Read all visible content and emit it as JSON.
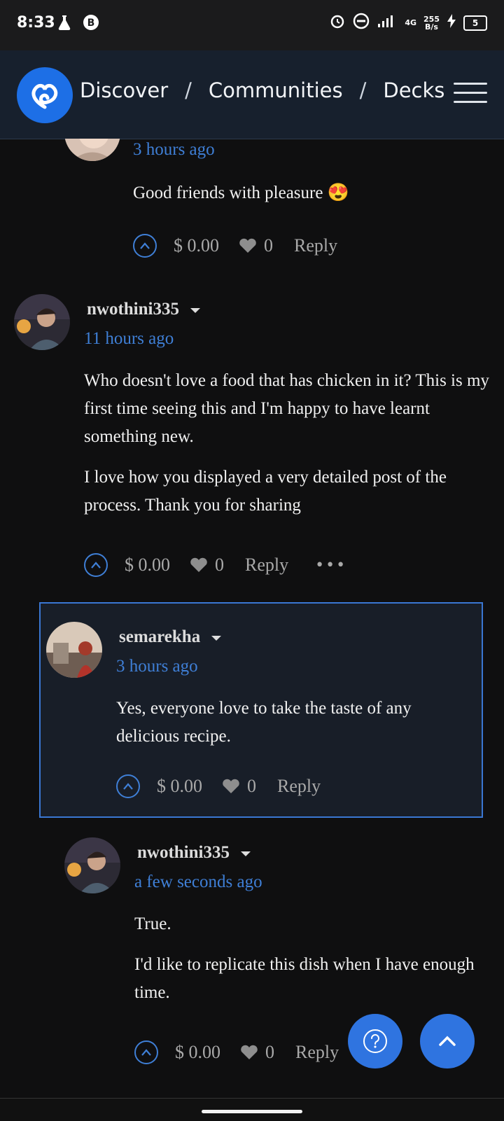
{
  "status_bar": {
    "time": "8:33",
    "net_speed_value": "255",
    "net_speed_unit": "B/s",
    "network_type": "4G",
    "battery": "5"
  },
  "header": {
    "breadcrumbs": [
      "Discover",
      "Communities",
      "Decks"
    ],
    "separator": "/"
  },
  "comments": [
    {
      "author": "",
      "time": "3 hours ago",
      "paragraphs": [
        "Good friends with pleasure 😍"
      ],
      "payout": "$ 0.00",
      "likes": "0",
      "reply_label": "Reply"
    },
    {
      "author": "nwothini335",
      "time": "11 hours ago",
      "paragraphs": [
        "Who doesn't love a food that has chicken in it? This is my first time seeing this and I'm happy to have learnt something new.",
        "I love how you displayed a very detailed post of the process. Thank you for sharing"
      ],
      "payout": "$ 0.00",
      "likes": "0",
      "reply_label": "Reply",
      "more_label": "•••"
    },
    {
      "author": "semarekha",
      "time": "3 hours ago",
      "paragraphs": [
        "Yes, everyone love to take the taste of any delicious recipe."
      ],
      "payout": "$ 0.00",
      "likes": "0",
      "reply_label": "Reply"
    },
    {
      "author": "nwothini335",
      "time": "a few seconds ago",
      "paragraphs": [
        "True.",
        "I'd like to replicate this dish when I have enough time."
      ],
      "payout": "$ 0.00",
      "likes": "0",
      "reply_label": "Reply"
    }
  ],
  "fab": {
    "help_icon": "question-circle-icon",
    "scroll_top_icon": "chevron-up-icon"
  },
  "colors": {
    "accent": "#2f74e0",
    "link": "#3f7fd6",
    "background": "#0f0f10",
    "header": "#17202d"
  }
}
